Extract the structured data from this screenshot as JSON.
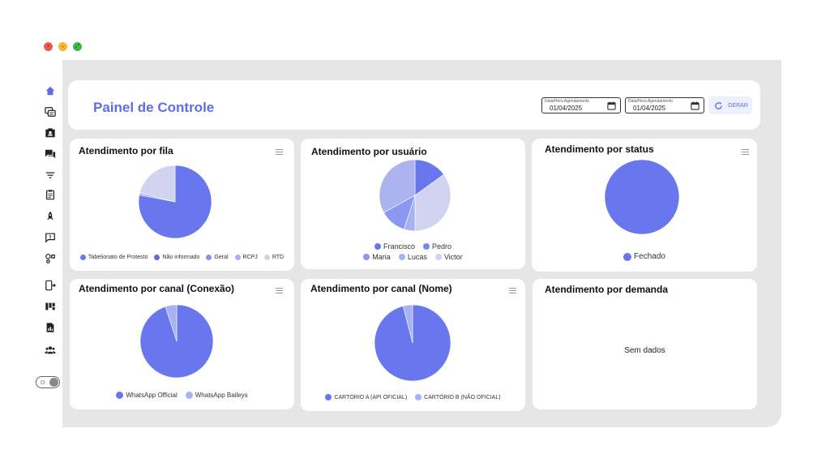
{
  "window": {
    "controls": {
      "close": "×",
      "minimize": "–",
      "maximize": "⤢"
    }
  },
  "sidebar": {
    "items": [
      {
        "name": "home-icon",
        "color": "#5b6ee8"
      },
      {
        "name": "tickets-icon",
        "color": "#222"
      },
      {
        "name": "contacts-icon",
        "color": "#222"
      },
      {
        "name": "chat-icon",
        "color": "#222"
      },
      {
        "name": "filter-icon",
        "color": "#222"
      },
      {
        "name": "clipboard-icon",
        "color": "#222"
      },
      {
        "name": "rocket-icon",
        "color": "#222"
      },
      {
        "name": "message-alert-icon",
        "color": "#222"
      },
      {
        "name": "connections-icon",
        "color": "#222"
      },
      {
        "name": "logout-device-icon",
        "color": "#222"
      },
      {
        "name": "kanban-icon",
        "color": "#222"
      },
      {
        "name": "report-icon",
        "color": "#222"
      },
      {
        "name": "users-icon",
        "color": "#222"
      }
    ],
    "theme_toggle": {
      "icon": "sun-icon",
      "glyph": "☼"
    }
  },
  "header": {
    "title": "Painel de Controle",
    "date_start": {
      "label": "Data/Hora Agendamento",
      "value": "01/04/2025"
    },
    "date_end": {
      "label": "Data/Hora Agendamento",
      "value": "01/04/2025"
    },
    "generate_label": "GERAR"
  },
  "colors": {
    "accent": "#5b6ee8",
    "pie_primary": "#6877ee",
    "pie_light": "#cfd3ef",
    "pie_mid": "#a6b0f0"
  },
  "cards": {
    "fila": {
      "title": "Atendimento por fila",
      "chart_data": {
        "type": "pie",
        "series": [
          {
            "name": "Tabelionato de Protesto",
            "value": 78,
            "color": "#6877ee"
          },
          {
            "name": "Não informado",
            "value": 0,
            "color": "#5e6ddb"
          },
          {
            "name": "Geral",
            "value": 0,
            "color": "#8794ee"
          },
          {
            "name": "RCPJ",
            "value": 1,
            "color": "#a8b1f1"
          },
          {
            "name": "RTD",
            "value": 21,
            "color": "#d0d4f0"
          }
        ]
      }
    },
    "usuario": {
      "title": "Atendimento por usuário",
      "chart_data": {
        "type": "pie",
        "series": [
          {
            "name": "Francisco",
            "value": 15,
            "color": "#6877ee"
          },
          {
            "name": "Pedro",
            "value": 0,
            "color": "#7886ee"
          },
          {
            "name": "Maria",
            "value": 0,
            "color": "#8c98ef"
          },
          {
            "name": "Lucas",
            "value": 0,
            "color": "#a8b1f1"
          },
          {
            "name": "Victor",
            "value": 0,
            "color": "#d0d4f0"
          },
          {
            "name": "",
            "value": 35,
            "color": "#d0d4f0"
          },
          {
            "name": "",
            "value": 5,
            "color": "#a8b1f1"
          },
          {
            "name": "",
            "value": 12,
            "color": "#8c98ef"
          },
          {
            "name": "",
            "value": 33,
            "color": "#abb4ef"
          }
        ]
      }
    },
    "status": {
      "title": "Atendimento por status",
      "chart_data": {
        "type": "pie",
        "series": [
          {
            "name": "Fechado",
            "value": 100,
            "color": "#6877ee"
          }
        ]
      }
    },
    "canal_conexao": {
      "title": "Atendimento por canal (Conexão)",
      "chart_data": {
        "type": "pie",
        "series": [
          {
            "name": "WhatsApp Official",
            "value": 95,
            "color": "#6877ee"
          },
          {
            "name": "WhatsApp Baileys",
            "value": 5,
            "color": "#a8b1f1"
          }
        ]
      }
    },
    "canal_nome": {
      "title": "Atendimento por canal (Nome)",
      "chart_data": {
        "type": "pie",
        "series": [
          {
            "name": "CARTÓRIO A (API OFICIAL)",
            "value": 96,
            "color": "#6877ee"
          },
          {
            "name": "CARTÓRIO B (NÃO OFICIAL)",
            "value": 4,
            "color": "#a8b1f1"
          }
        ]
      }
    },
    "demanda": {
      "title": "Atendimento por demanda",
      "empty_text": "Sem dados"
    }
  }
}
